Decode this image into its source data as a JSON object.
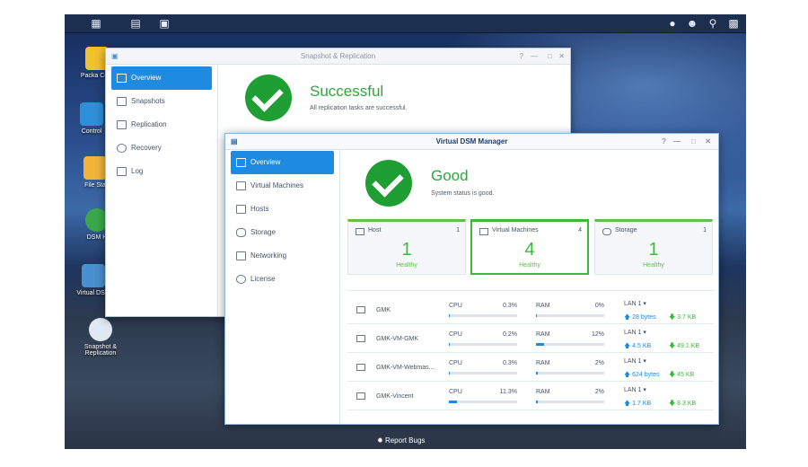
{
  "desktop": {
    "icons": [
      {
        "label": "Packa Cent"
      },
      {
        "label": "Control"
      },
      {
        "label": "File Sta"
      },
      {
        "label": "DSM H"
      },
      {
        "label": "Virtual DSM"
      },
      {
        "label": "Snapshot & Replication"
      }
    ],
    "report_bugs": "Report Bugs"
  },
  "snapshot_window": {
    "title": "Snapshot & Replication",
    "nav": [
      "Overview",
      "Snapshots",
      "Replication",
      "Recovery",
      "Log"
    ],
    "status": "Successful",
    "status_text": "All replication tasks are successful."
  },
  "vdsm_window": {
    "title": "Virtual DSM Manager",
    "nav": [
      "Overview",
      "Virtual Machines",
      "Hosts",
      "Storage",
      "Networking",
      "License"
    ],
    "status": "Good",
    "status_text": "System status is good.",
    "cards": [
      {
        "label": "Host",
        "count": "1",
        "number": "1",
        "health": "Healthy"
      },
      {
        "label": "Virtual Machines",
        "count": "4",
        "number": "4",
        "health": "Healthy"
      },
      {
        "label": "Storage",
        "count": "1",
        "number": "1",
        "health": "Healthy"
      }
    ],
    "vms": [
      {
        "name": "GMK",
        "cpu_label": "CPU",
        "cpu": "0.3%",
        "cpu_frac": 0.003,
        "ram_label": "RAM",
        "ram": "0%",
        "ram_frac": 0.0,
        "lan": "LAN 1 ▾",
        "up": "28 bytes",
        "down": "3.7 KB"
      },
      {
        "name": "GMK-VM-GMK",
        "cpu_label": "CPU",
        "cpu": "0.2%",
        "cpu_frac": 0.002,
        "ram_label": "RAM",
        "ram": "12%",
        "ram_frac": 0.12,
        "lan": "LAN 1 ▾",
        "up": "4.5 KB",
        "down": "49.1 KB"
      },
      {
        "name": "GMK-VM-Webmas...",
        "cpu_label": "CPU",
        "cpu": "0.3%",
        "cpu_frac": 0.003,
        "ram_label": "RAM",
        "ram": "2%",
        "ram_frac": 0.02,
        "lan": "LAN 1 ▾",
        "up": "624 bytes",
        "down": "45 KB"
      },
      {
        "name": "GMK-Vincent",
        "cpu_label": "CPU",
        "cpu": "11.3%",
        "cpu_frac": 0.113,
        "ram_label": "RAM",
        "ram": "2%",
        "ram_frac": 0.02,
        "lan": "LAN 1 ▾",
        "up": "1.7 KB",
        "down": "8.3 KB"
      }
    ]
  },
  "colors": {
    "accent": "#1e8ae0",
    "success": "#1f9e34",
    "healthy": "#3dba3a"
  }
}
